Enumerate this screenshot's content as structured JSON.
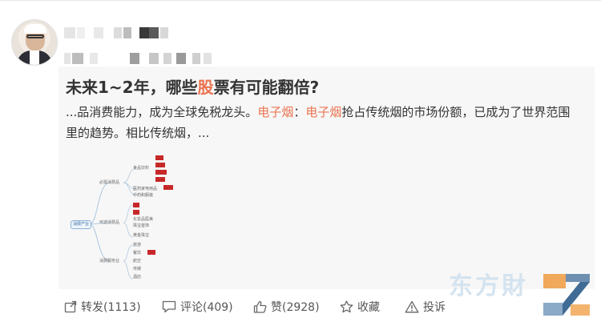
{
  "post": {
    "title_pre": "未来1~2年，哪些",
    "title_hl": "股",
    "title_post": "票有可能翻倍?",
    "excerpt_p1": "...品消费能力，成为全球免税龙头。",
    "excerpt_hl1": "电子烟",
    "excerpt_p2": "：",
    "excerpt_hl2": "电子烟",
    "excerpt_p3": "抢占传统烟的市场份额，已成为了世界范围里的趋势。相比传统烟，..."
  },
  "mindmap": {
    "root": "消费产业",
    "branches": [
      "必需消费品",
      "可选消费品",
      "消费服务业"
    ],
    "sub1": [
      "食品饮料",
      "医药家电用品",
      "中药和服装"
    ],
    "sub2": [
      "家电",
      "汽车",
      "化妆品医美",
      "珠宝首饰",
      "黄金珠宝"
    ],
    "sub3": [
      "旅游",
      "餐饮",
      "航空",
      "传媒",
      "酒店"
    ],
    "red1": [
      "白酒",
      "免税店",
      "休闲食品",
      "调味品",
      "化妆品"
    ],
    "red3": [
      "火锅"
    ]
  },
  "actions": {
    "repost": "转发(1113)",
    "comment": "评论(409)",
    "like": "赞(2928)",
    "favorite": "收藏",
    "report": "投诉"
  },
  "colors": {
    "accent": "#eb7350",
    "text": "#333333",
    "card_bg": "#f7f7f7"
  },
  "icons": [
    "repost-icon",
    "comment-icon",
    "like-icon",
    "favorite-icon",
    "report-icon"
  ]
}
